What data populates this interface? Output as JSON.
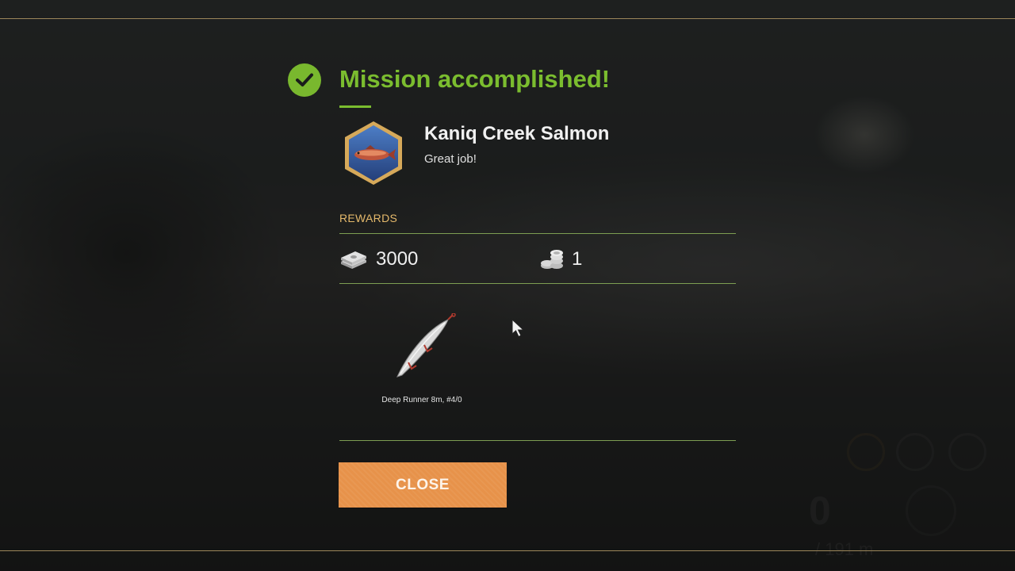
{
  "dialog": {
    "title": "Mission accomplished!",
    "mission_name": "Kaniq Creek Salmon",
    "mission_subtitle": "Great job!",
    "rewards_label": "REWARDS",
    "money": "3000",
    "coins": "1",
    "item_label": "Deep Runner 8m, #4/0",
    "close_label": "CLOSE"
  },
  "icons": {
    "status": "check-circle-icon",
    "mission_badge": "salmon-badge-icon",
    "money": "money-stack-icon",
    "coins": "coin-stack-icon",
    "item": "lure-icon",
    "cursor": "mouse-cursor-icon"
  },
  "colors": {
    "accent_green": "#7bbd2f",
    "rewards_gold": "#e5b96b",
    "button_orange": "#e7924a",
    "divider_green": "#7d9e52",
    "frame_gold": "#9c865a"
  }
}
